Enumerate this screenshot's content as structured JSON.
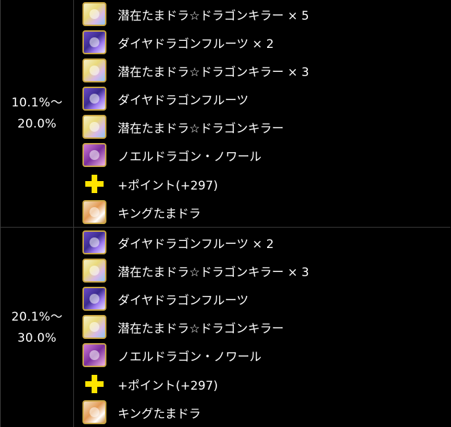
{
  "groups": [
    {
      "range_line1": "10.1%〜",
      "range_line2": "20.0%",
      "items": [
        {
          "icon": "tamadra-icon",
          "label": "潜在たまドラ☆ドラゴンキラー × 5"
        },
        {
          "icon": "diamond-dragon-fruit-icon",
          "label": "ダイヤドラゴンフルーツ × 2"
        },
        {
          "icon": "tamadra-icon",
          "label": "潜在たまドラ☆ドラゴンキラー × 3"
        },
        {
          "icon": "diamond-dragon-fruit-icon",
          "label": "ダイヤドラゴンフルーツ"
        },
        {
          "icon": "tamadra-icon",
          "label": "潜在たまドラ☆ドラゴンキラー"
        },
        {
          "icon": "noel-dragon-icon",
          "label": "ノエルドラゴン・ノワール"
        },
        {
          "icon": "plus-icon",
          "label": "+ポイント(+297)"
        },
        {
          "icon": "king-tamadra-icon",
          "label": "キングたまドラ"
        }
      ]
    },
    {
      "range_line1": "20.1%〜",
      "range_line2": "30.0%",
      "items": [
        {
          "icon": "diamond-dragon-fruit-icon",
          "label": "ダイヤドラゴンフルーツ × 2"
        },
        {
          "icon": "tamadra-icon",
          "label": "潜在たまドラ☆ドラゴンキラー × 3"
        },
        {
          "icon": "diamond-dragon-fruit-icon",
          "label": "ダイヤドラゴンフルーツ"
        },
        {
          "icon": "tamadra-icon",
          "label": "潜在たまドラ☆ドラゴンキラー"
        },
        {
          "icon": "noel-dragon-icon",
          "label": "ノエルドラゴン・ノワール"
        },
        {
          "icon": "plus-icon",
          "label": "+ポイント(+297)"
        },
        {
          "icon": "king-tamadra-icon",
          "label": "キングたまドラ"
        }
      ]
    }
  ],
  "colors": {
    "background": "#000000",
    "text": "#ffffff",
    "border": "#3a3a3a",
    "plus": "#ffe400"
  }
}
